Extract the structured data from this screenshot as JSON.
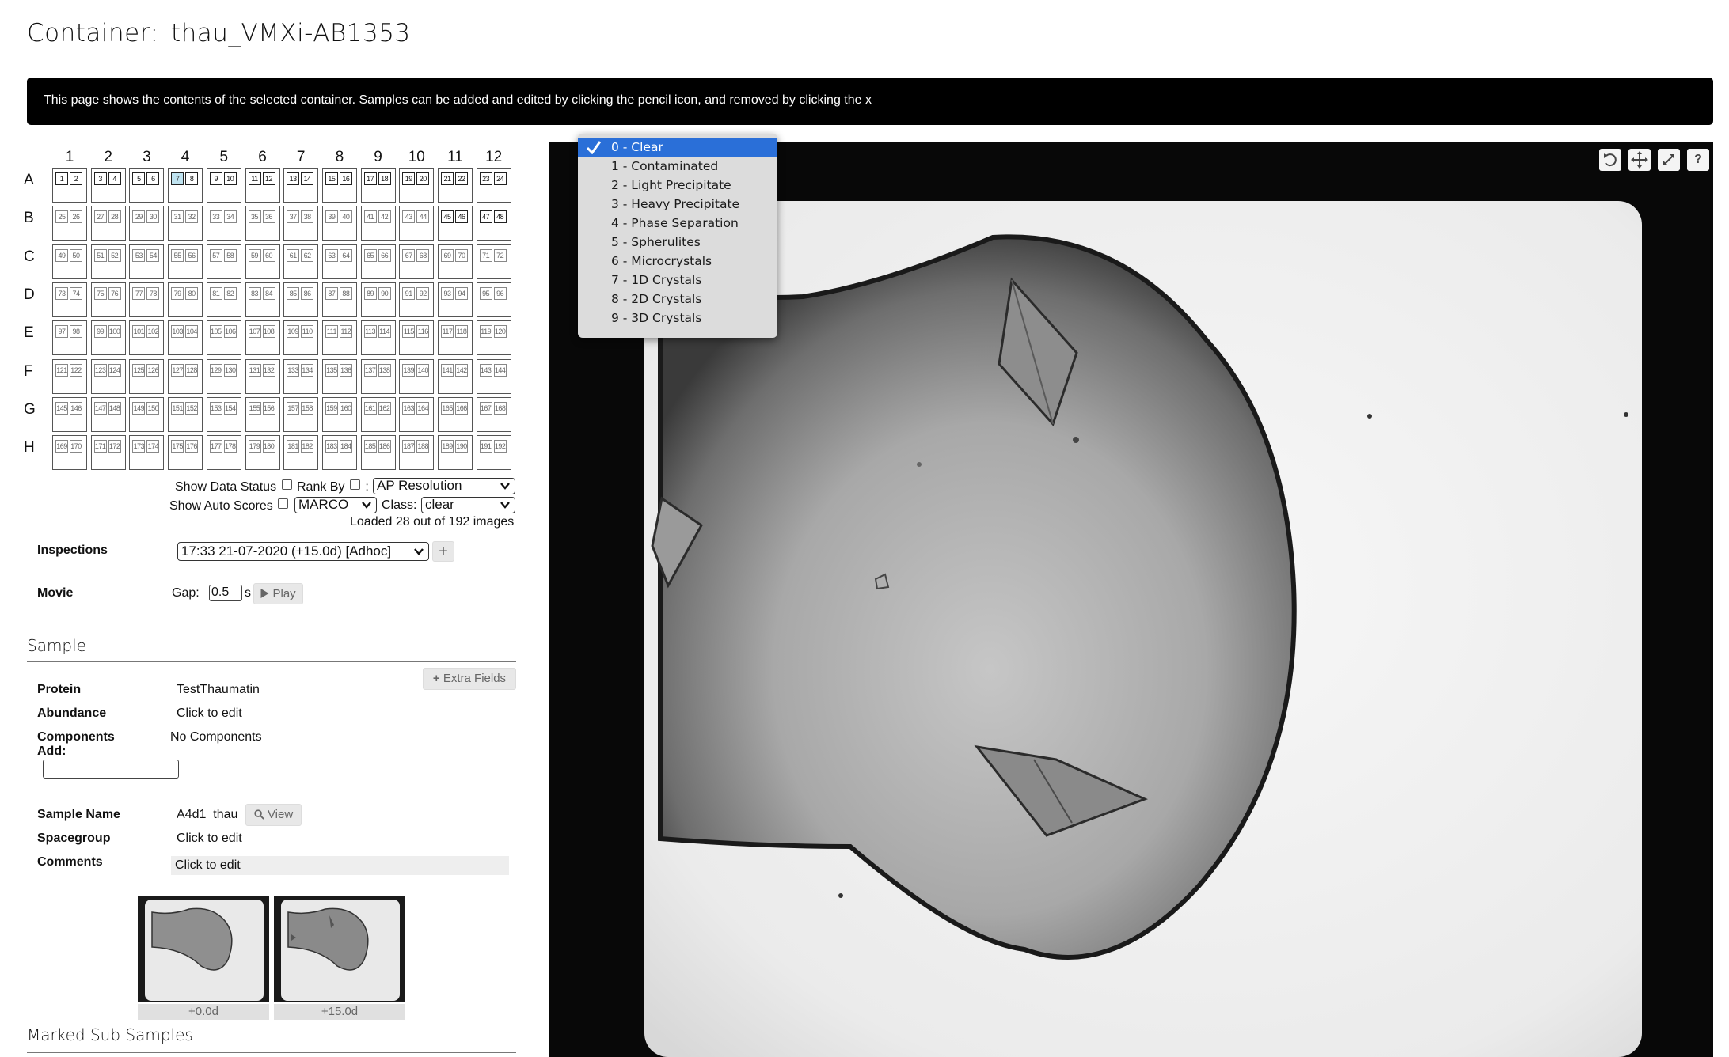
{
  "header": {
    "label": "Container:",
    "name": "thau_VMXi-AB1353"
  },
  "info": "This page shows the contents of the selected container. Samples can be added and edited by clicking the pencil icon, and removed by clicking the x",
  "plate": {
    "columns": [
      "1",
      "2",
      "3",
      "4",
      "5",
      "6",
      "7",
      "8",
      "9",
      "10",
      "11",
      "12"
    ],
    "rows": [
      "A",
      "B",
      "C",
      "D",
      "E",
      "F",
      "G",
      "H"
    ],
    "selected_drop": 7
  },
  "controls": {
    "show_data_status": "Show Data Status",
    "rank_by": "Rank By",
    "colon": ":",
    "rank_select": "AP Resolution",
    "show_auto_scores": "Show Auto Scores",
    "auto_select": "MARCO",
    "class_label": "Class:",
    "class_select": "clear",
    "loaded": "Loaded 28 out of 192 images"
  },
  "inspections": {
    "label": "Inspections",
    "value": "17:33 21-07-2020 (+15.0d) [Adhoc]",
    "add": "+"
  },
  "movie": {
    "label": "Movie",
    "gap_label": "Gap:",
    "gap_value": "0.5",
    "unit": "s",
    "play": "Play"
  },
  "sample": {
    "heading": "Sample",
    "extra_fields": "Extra Fields",
    "protein_label": "Protein",
    "protein_value": "TestThaumatin",
    "abundance_label": "Abundance",
    "abundance_value": "Click to edit",
    "components_label": "Components",
    "components_value": "No Components",
    "add_label": "Add:",
    "name_label": "Sample Name",
    "name_value": "A4d1_thau",
    "view": "View",
    "spacegroup_label": "Spacegroup",
    "spacegroup_value": "Click to edit",
    "comments_label": "Comments",
    "comments_value": "Click to edit"
  },
  "thumbs": [
    {
      "caption": "+0.0d"
    },
    {
      "caption": "+15.0d"
    }
  ],
  "marked": {
    "heading": "Marked Sub Samples"
  },
  "score_menu": {
    "items": [
      "0 - Clear",
      "1 - Contaminated",
      "2 - Light Precipitate",
      "3 - Heavy Precipitate",
      "4 - Phase Separation",
      "5 - Spherulites",
      "6 - Microcrystals",
      "7 - 1D Crystals",
      "8 - 2D Crystals",
      "9 - 3D Crystals"
    ],
    "selected": 0,
    "highlight_color": "#2a6fd8"
  },
  "viewer_tools": [
    "reset-icon",
    "move-icon",
    "expand-icon",
    "help-icon"
  ],
  "viewer_help": "?"
}
